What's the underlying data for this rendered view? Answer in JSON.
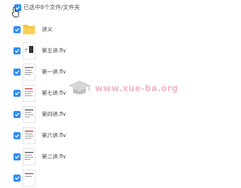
{
  "header": {
    "selection_text": "已选中8个文件/文件夹"
  },
  "files": [
    {
      "name": "讲义",
      "kind": "folder"
    },
    {
      "name": "第五讲.flv",
      "kind": "video"
    },
    {
      "name": "第一讲.flv",
      "kind": "video"
    },
    {
      "name": "第七讲.flv",
      "kind": "video"
    },
    {
      "name": "第四讲.flv",
      "kind": "video"
    },
    {
      "name": "第六讲.flv",
      "kind": "video"
    },
    {
      "name": "第二讲.flv",
      "kind": "video"
    },
    {
      "name": "",
      "kind": "video"
    }
  ],
  "watermark": {
    "text": "www.xue-ba.org"
  },
  "colors": {
    "accent": "#2f8df7",
    "folder": "#f5c242",
    "watermark": "#f2b8c8"
  }
}
